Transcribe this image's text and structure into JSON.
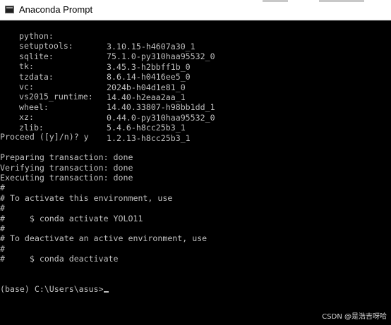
{
  "window": {
    "title": "Anaconda Prompt"
  },
  "packages": [
    {
      "name": "python:",
      "version": "3.10.15-h4607a30_1"
    },
    {
      "name": "setuptools:",
      "version": "75.1.0-py310haa95532_0"
    },
    {
      "name": "sqlite:",
      "version": "3.45.3-h2bbff1b_0"
    },
    {
      "name": "tk:",
      "version": "8.6.14-h0416ee5_0"
    },
    {
      "name": "tzdata:",
      "version": "2024b-h04d1e81_0"
    },
    {
      "name": "vc:",
      "version": "14.40-h2eaa2aa_1"
    },
    {
      "name": "vs2015_runtime:",
      "version": "14.40.33807-h98bb1dd_1"
    },
    {
      "name": "wheel:",
      "version": "0.44.0-py310haa95532_0"
    },
    {
      "name": "xz:",
      "version": "5.4.6-h8cc25b3_1"
    },
    {
      "name": "zlib:",
      "version": "1.2.13-h8cc25b3_1"
    }
  ],
  "output": {
    "proceed": "Proceed ([y]/n)? y",
    "preparing": "Preparing transaction: done",
    "verifying": "Verifying transaction: done",
    "executing": "Executing transaction: done",
    "hash1": "#",
    "activate_hint": "# To activate this environment, use",
    "hash2": "#",
    "activate_cmd": "#     $ conda activate YOLO11",
    "hash3": "#",
    "deactivate_hint": "# To deactivate an active environment, use",
    "hash4": "#",
    "deactivate_cmd": "#     $ conda deactivate",
    "prompt": "(base) C:\\Users\\asus>"
  },
  "watermark": "CSDN @是浩吉呀哈"
}
